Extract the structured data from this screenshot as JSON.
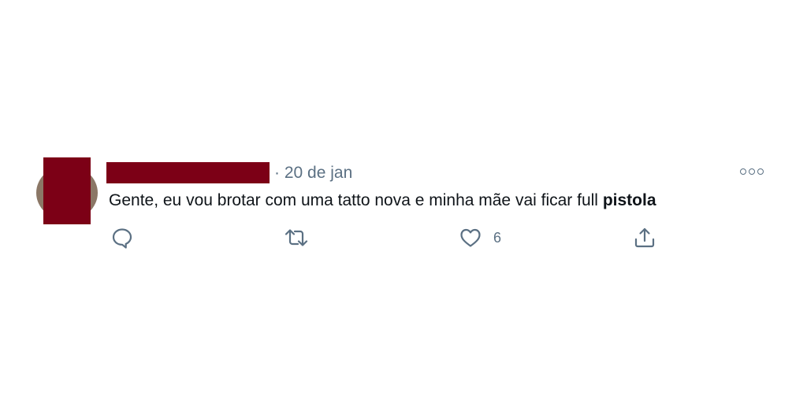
{
  "tweet": {
    "author": "",
    "separator": "·",
    "date": "20 de jan",
    "text_plain": "Gente, eu vou brotar com uma tatto nova e minha mãe vai ficar full",
    "text_bold": "pistola",
    "actions": {
      "reply_count": "",
      "retweet_count": "",
      "like_count": "6",
      "share_count": ""
    }
  },
  "icons": {
    "reply": "comment-icon",
    "retweet": "retweet-icon",
    "like": "heart-icon",
    "share": "share-icon",
    "more": "more-icon"
  },
  "colors": {
    "redaction": "#7c0016",
    "muted": "#5b7083",
    "text": "#0f1419",
    "background": "#ffffff"
  }
}
